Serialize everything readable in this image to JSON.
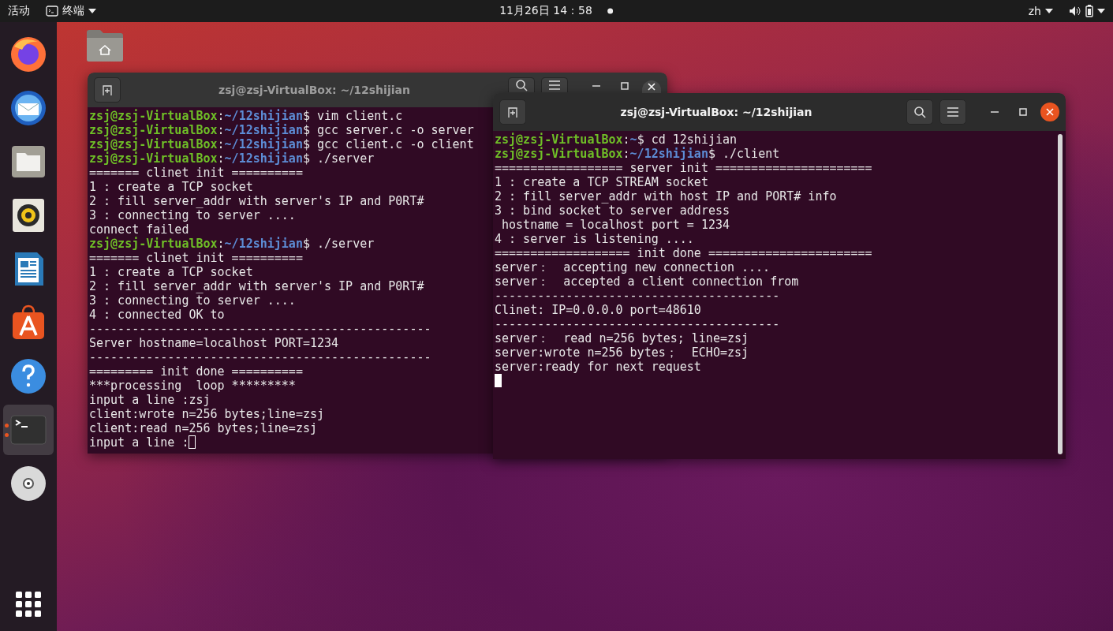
{
  "top_bar": {
    "activities": "活动",
    "app_menu": "终端",
    "clock": "11月26日 14：58",
    "input_method": "zh"
  },
  "dock": {
    "items": [
      {
        "kind": "browser",
        "running": false,
        "selected": false
      },
      {
        "kind": "mail",
        "running": false,
        "selected": false
      },
      {
        "kind": "files",
        "running": false,
        "selected": false
      },
      {
        "kind": "music",
        "running": false,
        "selected": false
      },
      {
        "kind": "writer",
        "running": false,
        "selected": false
      },
      {
        "kind": "store",
        "running": false,
        "selected": false
      },
      {
        "kind": "help",
        "running": false,
        "selected": false
      },
      {
        "kind": "terminal",
        "running": true,
        "selected": true
      },
      {
        "kind": "disc",
        "running": false,
        "selected": false
      }
    ]
  },
  "windows": [
    {
      "title": "zsj@zsj-VirtualBox: ~/12shijian",
      "focused": false,
      "lines": [
        {
          "kind": "prompt",
          "user": "zsj@zsj-VirtualBox",
          "sep": ":",
          "path": "~/12shijian",
          "rest": "$ vim client.c"
        },
        {
          "kind": "prompt",
          "user": "zsj@zsj-VirtualBox",
          "sep": ":",
          "path": "~/12shijian",
          "rest": "$ gcc server.c -o server"
        },
        {
          "kind": "prompt",
          "user": "zsj@zsj-VirtualBox",
          "sep": ":",
          "path": "~/12shijian",
          "rest": "$ gcc client.c -o client"
        },
        {
          "kind": "prompt",
          "user": "zsj@zsj-VirtualBox",
          "sep": ":",
          "path": "~/12shijian",
          "rest": "$ ./server"
        },
        {
          "kind": "output",
          "text": "======= clinet init =========="
        },
        {
          "kind": "output",
          "text": "1 : create a TCP socket"
        },
        {
          "kind": "output",
          "text": "2 : fill server_addr with server's IP and P0RT#"
        },
        {
          "kind": "output",
          "text": "3 : connecting to server ...."
        },
        {
          "kind": "output",
          "text": "connect failed"
        },
        {
          "kind": "prompt",
          "user": "zsj@zsj-VirtualBox",
          "sep": ":",
          "path": "~/12shijian",
          "rest": "$ ./server"
        },
        {
          "kind": "output",
          "text": "======= clinet init =========="
        },
        {
          "kind": "output",
          "text": "1 : create a TCP socket"
        },
        {
          "kind": "output",
          "text": "2 : fill server_addr with server's IP and P0RT#"
        },
        {
          "kind": "output",
          "text": "3 : connecting to server ...."
        },
        {
          "kind": "output",
          "text": "4 : connected OK to"
        },
        {
          "kind": "output",
          "text": "------------------------------------------------"
        },
        {
          "kind": "output",
          "text": "Server hostname=localhost PORT=1234"
        },
        {
          "kind": "output",
          "text": "------------------------------------------------"
        },
        {
          "kind": "output",
          "text": "========= init done =========="
        },
        {
          "kind": "output",
          "text": "***processing  loop *********"
        },
        {
          "kind": "output",
          "text": "input a line :zsj"
        },
        {
          "kind": "output",
          "text": "client:wrote n=256 bytes;line=zsj"
        },
        {
          "kind": "output",
          "text": "client:read n=256 bytes;line=zsj"
        },
        {
          "kind": "input",
          "text": "input a line :"
        }
      ]
    },
    {
      "title": "zsj@zsj-VirtualBox: ~/12shijian",
      "focused": true,
      "lines": [
        {
          "kind": "prompt",
          "user": "zsj@zsj-VirtualBox",
          "sep": ":",
          "path": "~",
          "rest": "$ cd 12shijian"
        },
        {
          "kind": "prompt",
          "user": "zsj@zsj-VirtualBox",
          "sep": ":",
          "path": "~/12shijian",
          "rest": "$ ./client"
        },
        {
          "kind": "output",
          "text": "================== server init ======================"
        },
        {
          "kind": "output",
          "text": "1 : create a TCP STREAM socket"
        },
        {
          "kind": "output",
          "text": "2 : fill server_addr with host IP and PORT# info"
        },
        {
          "kind": "output",
          "text": "3 : bind socket to server address"
        },
        {
          "kind": "output",
          "text": " hostname = localhost port = 1234"
        },
        {
          "kind": "output",
          "text": "4 : server is listening ...."
        },
        {
          "kind": "output",
          "text": "=================== init done ======================="
        },
        {
          "kind": "output",
          "text": "server：  accepting new connection ...."
        },
        {
          "kind": "output",
          "text": "server：  accepted a client connection from"
        },
        {
          "kind": "output",
          "text": "----------------------------------------"
        },
        {
          "kind": "output",
          "text": "Clinet: IP=0.0.0.0 port=48610"
        },
        {
          "kind": "output",
          "text": "----------------------------------------"
        },
        {
          "kind": "output",
          "text": "server：  read n=256 bytes; line=zsj"
        },
        {
          "kind": "output",
          "text": "server:wrote n=256 bytes；  ECHO=zsj"
        },
        {
          "kind": "output",
          "text": "server:ready for next request"
        },
        {
          "kind": "input"
        }
      ]
    }
  ]
}
